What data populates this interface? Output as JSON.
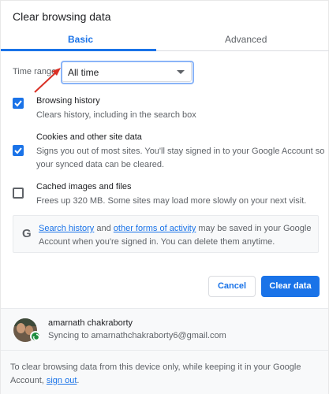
{
  "dialog": {
    "title": "Clear browsing data"
  },
  "tabs": [
    {
      "label": "Basic",
      "active": true
    },
    {
      "label": "Advanced",
      "active": false
    }
  ],
  "time_range": {
    "label": "Time range",
    "selected": "All time"
  },
  "options": [
    {
      "title": "Browsing history",
      "desc_lines": [
        "Clears history, including in the search box"
      ],
      "checked": true
    },
    {
      "title": "Cookies and other site data",
      "desc_lines": [
        "Signs you out of most sites. You'll stay signed in to your Google Account so",
        "your synced data can be cleared."
      ],
      "checked": true
    },
    {
      "title": "Cached images and files",
      "desc_lines": [
        "Frees up 320 MB. Some sites may load more slowly on your next visit."
      ],
      "checked": false
    }
  ],
  "google_notice": {
    "icon": "G",
    "link1": "Search history",
    "text1": " and ",
    "link2": "other forms of activity",
    "text2": " may be saved in your Google",
    "line2": "Account when you're signed in. You can delete them anytime."
  },
  "buttons": {
    "cancel": "Cancel",
    "clear": "Clear data"
  },
  "account": {
    "name": "amarnath chakraborty",
    "sync": "Syncing to amarnathchakraborty6@gmail.com"
  },
  "footer": {
    "line1": "To clear browsing data from this device only, while keeping it in your Google",
    "line2_prefix": "Account, ",
    "sign_out": "sign out",
    "line2_suffix": "."
  },
  "colors": {
    "accent": "#1a73e8",
    "sync_badge": "#1e8e3e",
    "annotation_arrow": "#d93025"
  }
}
